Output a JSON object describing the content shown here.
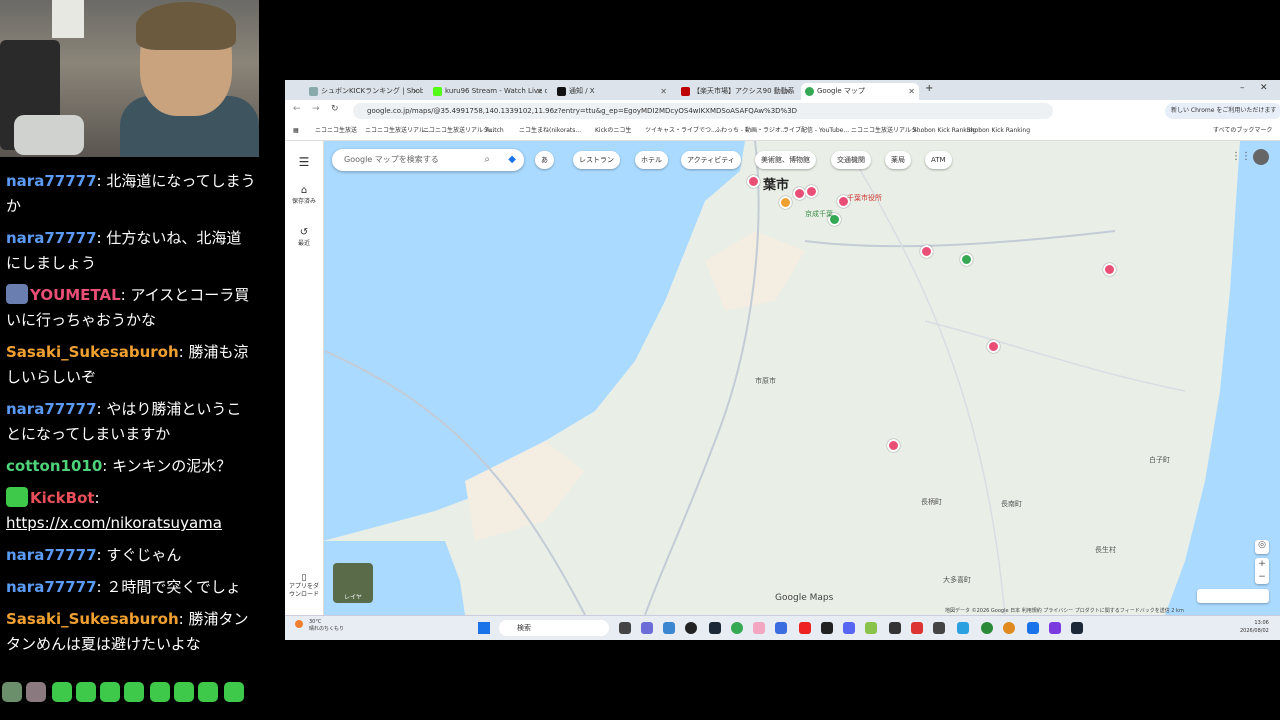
{
  "chat": {
    "messages": [
      {
        "user": "nara77777",
        "user_color": "#5b9bf5",
        "text": "北海道になってしまうか"
      },
      {
        "user": "nara77777",
        "user_color": "#5b9bf5",
        "text": "仕方ないね、北海道にしましょう"
      },
      {
        "user": "YOUMETAL",
        "user_color": "#e94f76",
        "text": "アイスとコーラ買いに行っちゃおうかな",
        "badge": true
      },
      {
        "user": "Sasaki_Sukesaburoh",
        "user_color": "#f0a030",
        "text": "勝浦も涼しいらしいぞ"
      },
      {
        "user": "nara77777",
        "user_color": "#5b9bf5",
        "text": "やはり勝浦ということになってしまいますか"
      },
      {
        "user": "cotton1010",
        "user_color": "#4ed27a",
        "text": "キンキンの泥水？"
      },
      {
        "user": "KickBot",
        "user_color": "#e94f5a",
        "text": "https://x.com/nikoratsuyama",
        "badge": true,
        "link": true
      },
      {
        "user": "nara77777",
        "user_color": "#5b9bf5",
        "text": "すぐじゃん"
      },
      {
        "user": "nara77777",
        "user_color": "#5b9bf5",
        "text": "２時間で突くでしょ"
      },
      {
        "user": "Sasaki_Sukesaburoh",
        "user_color": "#f0a030",
        "text": "勝浦タンタンめんは夏は避けたいよな"
      }
    ]
  },
  "browser": {
    "tabs": [
      {
        "label": "シュボンKICKランキング | Shobon K"
      },
      {
        "label": "kuru96 Stream - Watch Live on"
      },
      {
        "label": "通知 / X"
      },
      {
        "label": "【楽天市場】アクシス90 動動系の雨"
      },
      {
        "label": "Google マップ",
        "active": true
      }
    ],
    "new_tab": "+",
    "url": "google.co.jp/maps/@35.4991758,140.1339102,11.96z?entry=ttu&g_ep=EgoyMDI2MDcyOS4wIKXMDSoASAFQAw%3D%3D",
    "chrome_button": "新しい Chrome をご利用いただけます",
    "bookmarks": [
      "ニコニコ生放送",
      "ニコニコ生放送リアル...",
      "ニコニコ生放送リアルタ...",
      "Twitch",
      "ニコ生まね(nikorats...",
      "Kickのニコ生",
      "ツイキャス・ライブでつ...",
      "ふわっち - 動画・ラジオ...",
      "ライブ配信 - YouTube...",
      "ニコニコ生放送リアルタ...",
      "Shobon Kick Ranking",
      "Shobon Kick Ranking",
      "すべてのブックマーク"
    ]
  },
  "map": {
    "search_placeholder": "Google マップを検索する",
    "input_mode": "あ",
    "chips": [
      "レストラン",
      "ホテル",
      "アクティビティ",
      "美術館、博物館",
      "交通機関",
      "薬局",
      "ATM"
    ],
    "rail": {
      "saved": "保存済み",
      "recent": "最近",
      "app": "アプリをダウンロード",
      "layers": "レイヤ"
    },
    "city_label": "葉市",
    "place_labels": [
      "千葉市役所",
      "京成千葉",
      "市原市",
      "長柄町",
      "白子町",
      "長南町",
      "長生村",
      "大多喜町"
    ],
    "watermark": "Google Maps",
    "footer": "地図データ ©2026 Google 日本 利用規約 プライバシー プロダクトに関するフィードバックを送信 2 km"
  },
  "taskbar": {
    "weather_temp": "30°C",
    "weather_text": "晴れのちくもり",
    "search": "検索",
    "time": "13:06",
    "date": "2026/08/02"
  },
  "colors": {
    "accent": "#1a73e8",
    "pin": "#e94f76",
    "water": "#aadaff",
    "land": "#e9efe6"
  }
}
